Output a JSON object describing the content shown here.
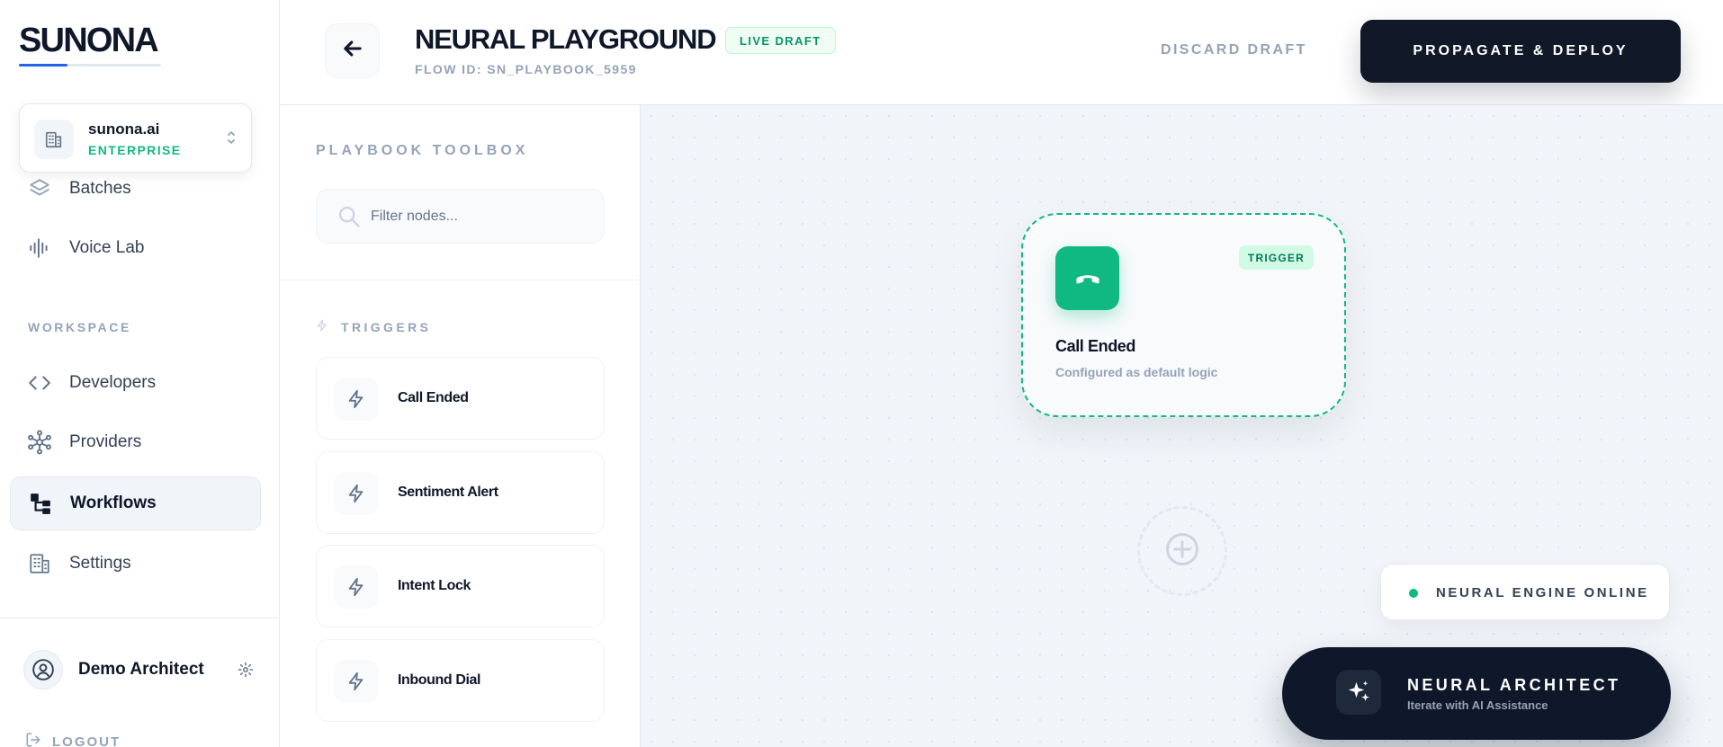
{
  "app": {
    "logo": "SUNONA",
    "accent_color": "#2563eb",
    "success_color": "#10b981",
    "dark_color": "#111827"
  },
  "org": {
    "name": "sunona.ai",
    "plan": "ENTERPRISE",
    "icon": "building-icon"
  },
  "sidebar": {
    "items": [
      {
        "label": "Batches",
        "icon": "layers-icon"
      },
      {
        "label": "Voice Lab",
        "icon": "waveform-icon"
      }
    ],
    "workspace_label": "WORKSPACE",
    "workspace_items": [
      {
        "label": "Developers",
        "icon": "code-icon"
      },
      {
        "label": "Providers",
        "icon": "network-icon"
      },
      {
        "label": "Workflows",
        "icon": "workflow-icon",
        "active": true
      },
      {
        "label": "Settings",
        "icon": "building-icon"
      }
    ],
    "user_name": "Demo Architect",
    "logout_label": "LOGOUT"
  },
  "header": {
    "title": "NEURAL PLAYGROUND",
    "badge": "LIVE DRAFT",
    "flow_id": "FLOW ID: SN_PLAYBOOK_5959",
    "discard_label": "DISCARD DRAFT",
    "deploy_label": "PROPAGATE & DEPLOY"
  },
  "toolbox": {
    "title": "PLAYBOOK TOOLBOX",
    "search_placeholder": "Filter nodes...",
    "triggers_label": "TRIGGERS",
    "nodes": [
      {
        "label": "Call Ended",
        "icon": "bolt-icon"
      },
      {
        "label": "Sentiment Alert",
        "icon": "bolt-icon"
      },
      {
        "label": "Intent Lock",
        "icon": "bolt-icon"
      },
      {
        "label": "Inbound Dial",
        "icon": "bolt-icon"
      }
    ]
  },
  "canvas": {
    "trigger_node": {
      "title": "Call Ended",
      "subtitle": "Configured as default logic",
      "badge": "TRIGGER",
      "icon": "phone-hangup-icon"
    },
    "engine_status": "NEURAL ENGINE ONLINE",
    "architect": {
      "title": "NEURAL ARCHITECT",
      "subtitle": "Iterate with AI Assistance",
      "icon": "sparkles-icon"
    }
  }
}
